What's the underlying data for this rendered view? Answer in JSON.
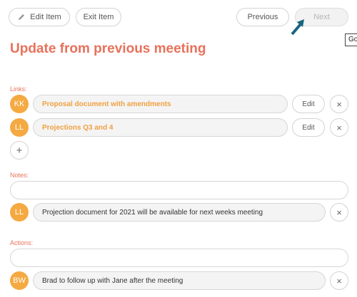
{
  "toolbar": {
    "edit_item_label": "Edit Item",
    "exit_item_label": "Exit Item",
    "previous_label": "Previous",
    "next_label": "Next",
    "tooltip_text": "Go"
  },
  "title": "Update from previous meeting",
  "links": {
    "label": "Links:",
    "items": [
      {
        "initials": "KK",
        "text": "Proposal document with amendments",
        "edit_label": "Edit",
        "remove": "×"
      },
      {
        "initials": "LL",
        "text": "Projections Q3 and 4",
        "edit_label": "Edit",
        "remove": "×"
      }
    ],
    "add": "+"
  },
  "notes": {
    "label": "Notes:",
    "input_value": "",
    "items": [
      {
        "initials": "LL",
        "text": "Projection document for 2021 will be available for next weeks meeting",
        "remove": "×"
      }
    ]
  },
  "actions": {
    "label": "Actions:",
    "input_value": "",
    "items": [
      {
        "initials": "BW",
        "text": "Brad to follow up with Jane after the meeting",
        "remove": "×"
      }
    ]
  },
  "colors": {
    "accent": "#e8715b",
    "avatar": "#f5a941",
    "link_text": "#f0a040",
    "arrow": "#17657f"
  }
}
